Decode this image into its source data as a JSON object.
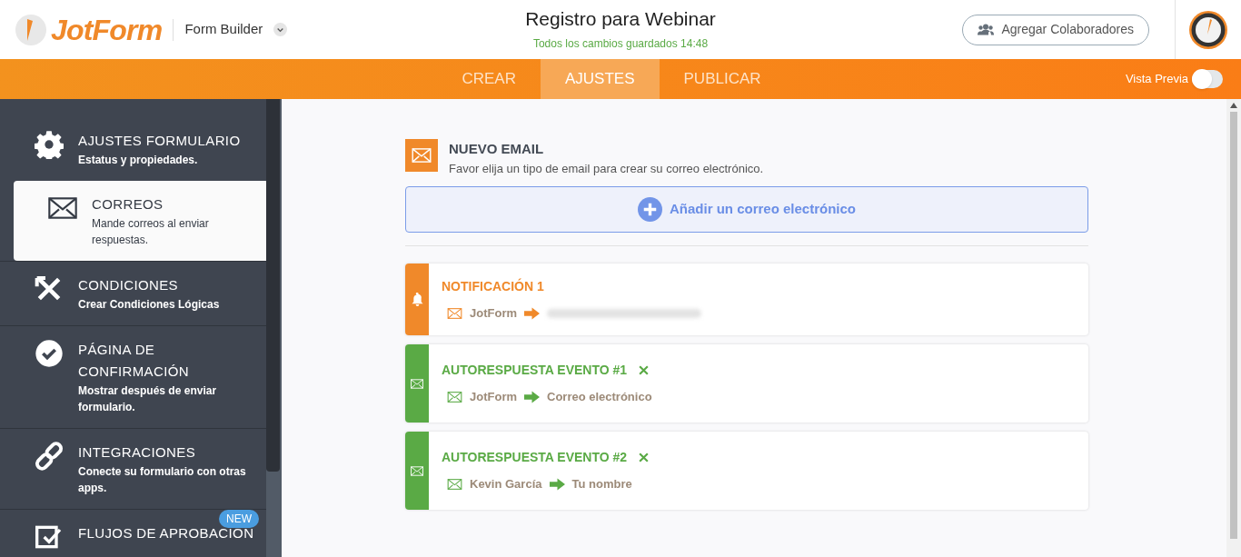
{
  "header": {
    "logo": "JotForm",
    "app_menu": "Form Builder",
    "title": "Registro para Webinar",
    "save_status": "Todos los cambios guardados 14:48",
    "collaborators_button": "Agregar Colaboradores"
  },
  "tabs": [
    {
      "label": "CREAR",
      "selected": false
    },
    {
      "label": "AJUSTES",
      "selected": true
    },
    {
      "label": "PUBLICAR",
      "selected": false
    }
  ],
  "preview": {
    "label": "Vista Previa",
    "on": false
  },
  "sidebar": {
    "items": [
      {
        "kind": "gear",
        "title": "AJUSTES FORMULARIO",
        "subtitle": "Estatus y propiedades.",
        "selected": false
      },
      {
        "kind": "mail",
        "title": "CORREOS",
        "subtitle": "Mande correos al enviar respuestas.",
        "selected": true
      },
      {
        "kind": "conditions",
        "title": "CONDICIONES",
        "subtitle": "Crear Condiciones Lógicas",
        "selected": false
      },
      {
        "kind": "check",
        "title": "PÁGINA DE CONFIRMACIÓN",
        "subtitle": "Mostrar después de enviar formulario.",
        "selected": false
      },
      {
        "kind": "link",
        "title": "INTEGRACIONES",
        "subtitle": "Conecte su formulario con otras apps.",
        "selected": false
      },
      {
        "kind": "approval",
        "title": "FLUJOS DE APROBACIÓN",
        "badge": "NEW",
        "selected": false
      }
    ]
  },
  "new_email": {
    "title": "NUEVO EMAIL",
    "description": "Favor elija un tipo de email para crear su correo electrónico.",
    "add_button": "Añadir un correo electrónico"
  },
  "emails": [
    {
      "kind": "notification",
      "color": "#f0892a",
      "title": "NOTIFICACIÓN 1",
      "from": "JotForm",
      "has_condition": false
    },
    {
      "kind": "autoresponder",
      "color": "#5aaa45",
      "title": "AUTORESPUESTA EVENTO #1",
      "from": "JotForm",
      "to": "Correo electrónico",
      "has_condition": true
    },
    {
      "kind": "autoresponder",
      "color": "#5aaa45",
      "title": "AUTORESPUESTA EVENTO #2",
      "from": "Kevin García",
      "to": "Tu nombre",
      "has_condition": true
    }
  ]
}
